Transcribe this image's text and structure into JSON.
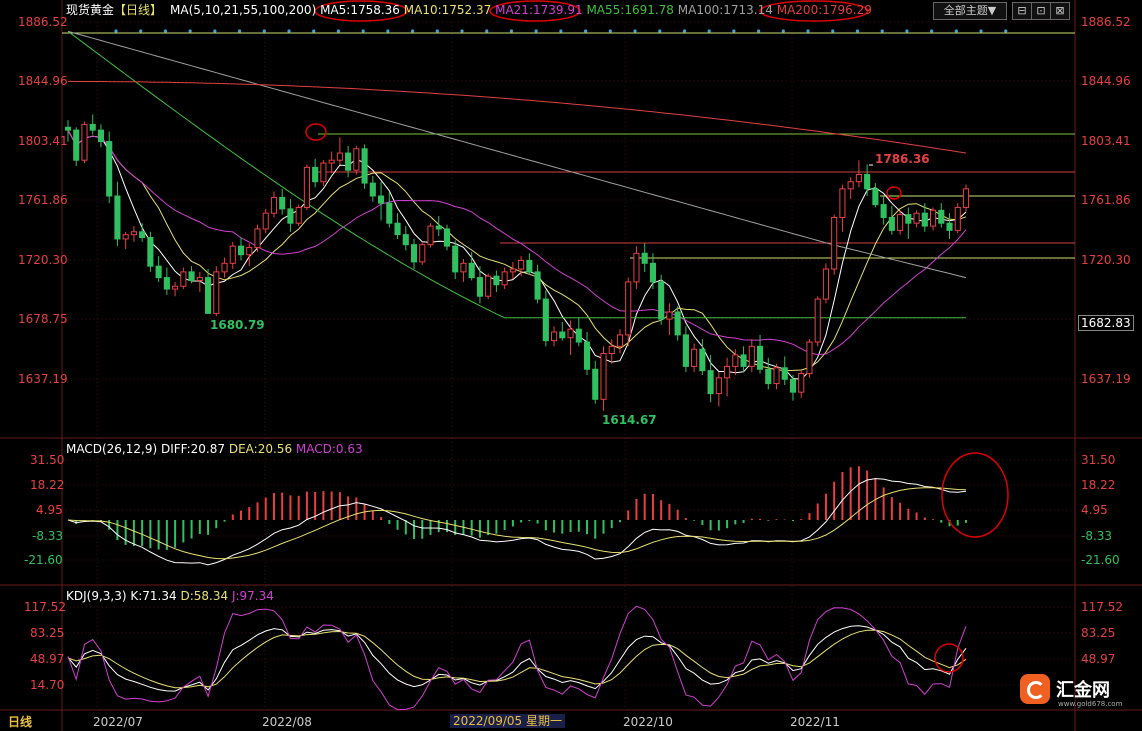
{
  "header": {
    "title": "现货黄金",
    "period": "【日线】",
    "ma_params": "MA(5,10,21,55,100,200)",
    "ma_values": [
      {
        "label": "MA5:1758.36",
        "color": "#ffffff"
      },
      {
        "label": "MA10:1752.37",
        "color": "#e8e070"
      },
      {
        "label": "MA21:1739.91",
        "color": "#d040d0"
      },
      {
        "label": "MA55:1691.78",
        "color": "#40c040"
      },
      {
        "label": "MA100:1713.14",
        "color": "#a0a0a0"
      },
      {
        "label": "MA200:1796.29",
        "color": "#e04040"
      }
    ],
    "theme_button": "全部主题▼",
    "window_buttons": [
      "⊟",
      "⊡",
      "⊠"
    ]
  },
  "price_axis": [
    "1886.52",
    "1844.96",
    "1803.41",
    "1761.86",
    "1720.30",
    "1678.75",
    "1637.19"
  ],
  "price_axis_range": [
    1600,
    1890
  ],
  "current_price_label": "1682.83",
  "annotations": {
    "high_label": "1786.36",
    "low1_label": "1680.79",
    "low2_label": "1614.67"
  },
  "macd": {
    "header": "MACD(26,12,9)",
    "diff": "DIFF:20.87",
    "dea": "DEA:20.56",
    "macd": "MACD:0.63",
    "axis": [
      "31.50",
      "18.22",
      "4.95",
      "-8.33",
      "-21.60"
    ]
  },
  "kdj": {
    "header": "KDJ(9,3,3)",
    "k": "K:71.34",
    "d": "D:58.34",
    "j": "J:97.34",
    "axis": [
      "117.52",
      "83.25",
      "48.97",
      "14.70"
    ]
  },
  "time_axis": {
    "period_label": "日线",
    "months": [
      "2022/07",
      "2022/08",
      "2022/10",
      "2022/11"
    ],
    "cursor_label": "2022/09/05 星期一"
  },
  "watermark": {
    "logo_text": "汇金网",
    "url": "www.gold678.com"
  },
  "colors": {
    "up": "#e84040",
    "down": "#30c060",
    "ma5": "#ffffff",
    "ma10": "#e8e070",
    "ma21": "#d040d0",
    "ma55": "#40c040",
    "ma100": "#a0a0a0",
    "ma200": "#e04040",
    "highlight_circle": "#e00000"
  },
  "chart_data": {
    "type": "candlestick",
    "candles": [
      [
        1813,
        1818,
        1803,
        1811
      ],
      [
        1811,
        1813,
        1786,
        1790
      ],
      [
        1790,
        1817,
        1788,
        1815
      ],
      [
        1815,
        1822,
        1808,
        1811
      ],
      [
        1811,
        1815,
        1799,
        1803
      ],
      [
        1803,
        1810,
        1760,
        1765
      ],
      [
        1765,
        1775,
        1730,
        1735
      ],
      [
        1735,
        1740,
        1728,
        1738
      ],
      [
        1738,
        1744,
        1733,
        1740
      ],
      [
        1740,
        1746,
        1733,
        1736
      ],
      [
        1736,
        1740,
        1712,
        1716
      ],
      [
        1716,
        1723,
        1705,
        1708
      ],
      [
        1708,
        1715,
        1696,
        1700
      ],
      [
        1700,
        1705,
        1695,
        1702
      ],
      [
        1702,
        1715,
        1700,
        1712
      ],
      [
        1712,
        1716,
        1704,
        1706
      ],
      [
        1706,
        1712,
        1698,
        1708
      ],
      [
        1708,
        1714,
        1690,
        1683
      ],
      [
        1683,
        1716,
        1681,
        1712
      ],
      [
        1712,
        1722,
        1708,
        1718
      ],
      [
        1718,
        1733,
        1714,
        1730
      ],
      [
        1730,
        1736,
        1720,
        1724
      ],
      [
        1724,
        1732,
        1716,
        1729
      ],
      [
        1729,
        1745,
        1726,
        1742
      ],
      [
        1742,
        1756,
        1739,
        1753
      ],
      [
        1753,
        1768,
        1750,
        1764
      ],
      [
        1764,
        1770,
        1752,
        1756
      ],
      [
        1756,
        1763,
        1740,
        1746
      ],
      [
        1746,
        1759,
        1744,
        1757
      ],
      [
        1757,
        1787,
        1755,
        1785
      ],
      [
        1785,
        1791,
        1771,
        1775
      ],
      [
        1775,
        1790,
        1772,
        1788
      ],
      [
        1788,
        1796,
        1781,
        1790
      ],
      [
        1790,
        1806,
        1787,
        1795
      ],
      [
        1795,
        1800,
        1778,
        1783
      ],
      [
        1783,
        1800,
        1780,
        1798
      ],
      [
        1798,
        1801,
        1770,
        1774
      ],
      [
        1774,
        1779,
        1761,
        1765
      ],
      [
        1765,
        1775,
        1748,
        1760
      ],
      [
        1760,
        1768,
        1743,
        1746
      ],
      [
        1746,
        1753,
        1735,
        1738
      ],
      [
        1738,
        1744,
        1727,
        1731
      ],
      [
        1731,
        1735,
        1714,
        1719
      ],
      [
        1719,
        1733,
        1717,
        1731
      ],
      [
        1731,
        1746,
        1729,
        1744
      ],
      [
        1744,
        1751,
        1737,
        1742
      ],
      [
        1742,
        1745,
        1727,
        1730
      ],
      [
        1730,
        1734,
        1707,
        1712
      ],
      [
        1712,
        1721,
        1705,
        1718
      ],
      [
        1718,
        1726,
        1706,
        1708
      ],
      [
        1708,
        1716,
        1690,
        1695
      ],
      [
        1695,
        1711,
        1693,
        1709
      ],
      [
        1709,
        1713,
        1698,
        1703
      ],
      [
        1703,
        1715,
        1700,
        1712
      ],
      [
        1712,
        1719,
        1707,
        1714
      ],
      [
        1714,
        1723,
        1709,
        1720
      ],
      [
        1720,
        1725,
        1710,
        1712
      ],
      [
        1712,
        1717,
        1690,
        1693
      ],
      [
        1693,
        1699,
        1660,
        1664
      ],
      [
        1664,
        1674,
        1660,
        1670
      ],
      [
        1670,
        1677,
        1664,
        1666
      ],
      [
        1666,
        1678,
        1654,
        1672
      ],
      [
        1672,
        1680,
        1660,
        1663
      ],
      [
        1663,
        1670,
        1640,
        1644
      ],
      [
        1644,
        1650,
        1620,
        1623
      ],
      [
        1623,
        1660,
        1615,
        1655
      ],
      [
        1655,
        1665,
        1648,
        1660
      ],
      [
        1660,
        1672,
        1655,
        1668
      ],
      [
        1668,
        1708,
        1660,
        1705
      ],
      [
        1705,
        1730,
        1700,
        1725
      ],
      [
        1725,
        1732,
        1712,
        1718
      ],
      [
        1718,
        1725,
        1700,
        1705
      ],
      [
        1705,
        1710,
        1675,
        1679
      ],
      [
        1679,
        1690,
        1668,
        1684
      ],
      [
        1684,
        1688,
        1664,
        1668
      ],
      [
        1668,
        1674,
        1642,
        1646
      ],
      [
        1646,
        1662,
        1642,
        1658
      ],
      [
        1658,
        1665,
        1640,
        1643
      ],
      [
        1643,
        1654,
        1621,
        1627
      ],
      [
        1627,
        1642,
        1618,
        1638
      ],
      [
        1638,
        1652,
        1625,
        1646
      ],
      [
        1646,
        1658,
        1640,
        1654
      ],
      [
        1654,
        1660,
        1642,
        1646
      ],
      [
        1646,
        1665,
        1642,
        1660
      ],
      [
        1660,
        1668,
        1641,
        1644
      ],
      [
        1644,
        1652,
        1630,
        1634
      ],
      [
        1634,
        1648,
        1630,
        1645
      ],
      [
        1645,
        1653,
        1633,
        1637
      ],
      [
        1637,
        1640,
        1622,
        1628
      ],
      [
        1628,
        1643,
        1624,
        1641
      ],
      [
        1641,
        1665,
        1638,
        1663
      ],
      [
        1663,
        1695,
        1660,
        1693
      ],
      [
        1693,
        1718,
        1690,
        1714
      ],
      [
        1714,
        1752,
        1710,
        1750
      ],
      [
        1750,
        1773,
        1740,
        1770
      ],
      [
        1770,
        1778,
        1763,
        1775
      ],
      [
        1775,
        1790,
        1771,
        1780
      ],
      [
        1780,
        1787,
        1765,
        1770
      ],
      [
        1770,
        1774,
        1757,
        1759
      ],
      [
        1759,
        1765,
        1745,
        1750
      ],
      [
        1750,
        1758,
        1738,
        1741
      ],
      [
        1741,
        1755,
        1738,
        1752
      ],
      [
        1752,
        1757,
        1735,
        1746
      ],
      [
        1746,
        1755,
        1743,
        1753
      ],
      [
        1753,
        1760,
        1740,
        1744
      ],
      [
        1744,
        1757,
        1741,
        1755
      ],
      [
        1755,
        1760,
        1743,
        1746
      ],
      [
        1746,
        1753,
        1735,
        1741
      ],
      [
        1741,
        1760,
        1739,
        1757
      ],
      [
        1757,
        1773,
        1754,
        1770
      ]
    ],
    "series": [
      {
        "name": "MA5"
      },
      {
        "name": "MA10"
      },
      {
        "name": "MA21"
      },
      {
        "name": "MA55"
      },
      {
        "name": "MA100"
      },
      {
        "name": "MA200"
      }
    ]
  }
}
